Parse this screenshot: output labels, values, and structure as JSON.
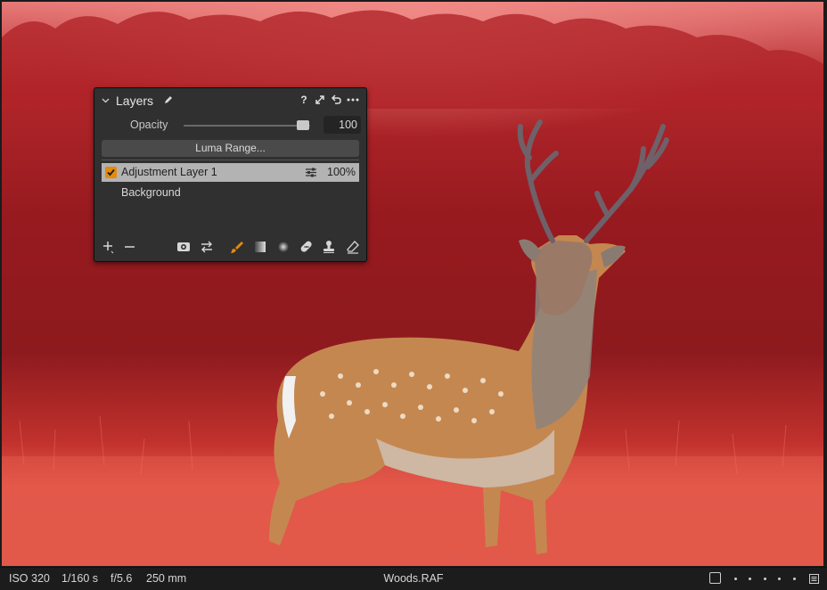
{
  "panel": {
    "title": "Layers",
    "header_icons": [
      "question-icon",
      "expand-icon",
      "reset-icon",
      "more-icon"
    ],
    "opacity_label": "Opacity",
    "opacity_value": "100",
    "opacity_fraction": 1.0,
    "luma_button": "Luma Range...",
    "layers": [
      {
        "name": "Adjustment Layer 1",
        "checked": true,
        "opacity": "100%",
        "selected": true
      },
      {
        "name": "Background",
        "checked": false,
        "opacity": "",
        "selected": false
      }
    ],
    "tools": [
      "add-icon",
      "remove-icon",
      "eye-icon",
      "swap-icon",
      "brush-icon",
      "gradient-icon",
      "radial-icon",
      "heal-icon",
      "clone-icon",
      "eraser-icon"
    ],
    "accent": "#e58a0a"
  },
  "status": {
    "iso": "ISO 320",
    "shutter": "1/160 s",
    "aperture": "f/5.6",
    "focal": "250 mm",
    "filename": "Woods.RAF"
  }
}
